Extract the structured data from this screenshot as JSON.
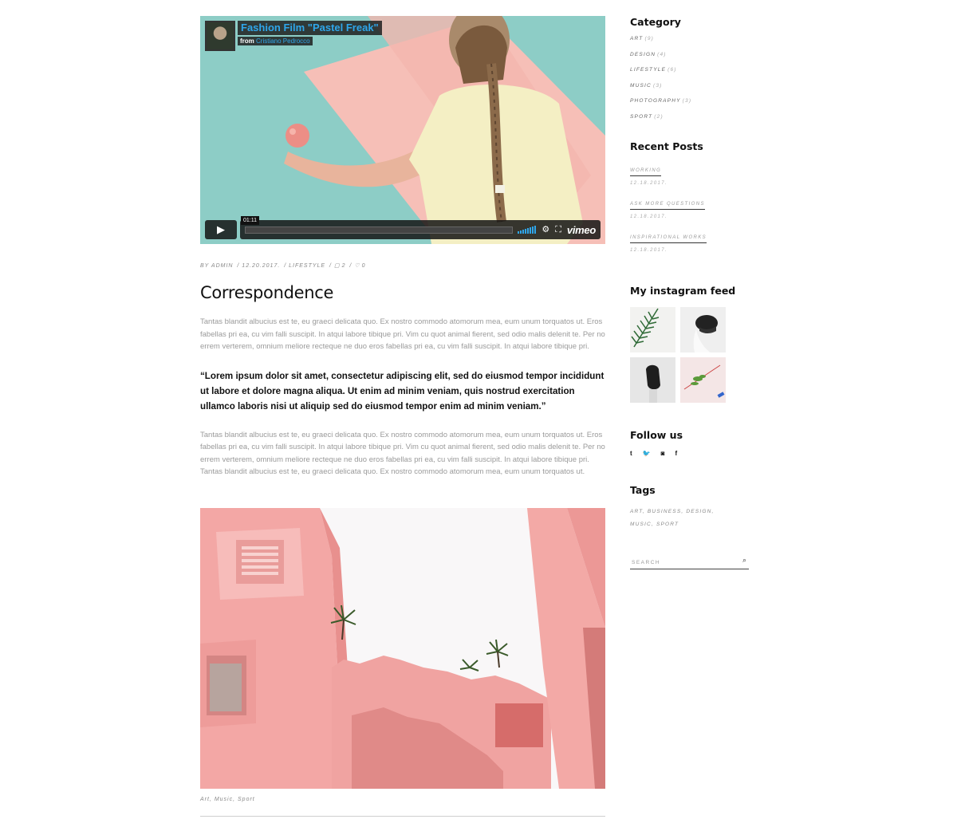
{
  "video": {
    "title": "Fashion Film \"Pastel Freak\"",
    "byline_prefix": "from",
    "author": "Cristiano Pedrocco",
    "time": "01:11",
    "progress": 0.0,
    "play_icon": "play-icon",
    "brand": "vimeo"
  },
  "post": {
    "meta": {
      "by": "BY ADMIN",
      "date": "12.20.2017.",
      "category": "LIFESTYLE",
      "comments": "2",
      "likes": "0"
    },
    "title": "Correspondence",
    "paragraph1": "Tantas blandit albucius est te, eu graeci delicata quo. Ex nostro commodo atomorum mea, eum unum torquatos ut. Eros fabellas pri ea, cu vim falli suscipit. In atqui labore tibique pri. Vim cu quot animal fierent, sed odio malis delenit te. Per no errem verterem, omnium meliore recteque ne duo eros fabellas pri ea, cu vim falli suscipit. In atqui labore tibique pri.",
    "quote": "“Lorem ipsum dolor sit amet, consectetur adipiscing elit, sed do eiusmod tempor incididunt ut labore et dolore magna aliqua. Ut enim ad minim veniam, quis nostrud exercitation ullamco laboris nisi ut aliquip sed do eiusmod tempor enim ad minim veniam.”",
    "paragraph2": "Tantas blandit albucius est te, eu graeci delicata quo. Ex nostro commodo atomorum mea, eum unum torquatos ut. Eros fabellas pri ea, cu vim falli suscipit. In atqui labore tibique pri. Vim cu quot animal fierent, sed odio malis delenit te. Per no errem verterem, omnium meliore recteque ne duo eros fabellas pri ea, cu vim falli suscipit. In atqui labore tibique pri. Tantas blandit albucius est te, eu graeci delicata quo. Ex nostro commodo atomorum mea, eum unum torquatos ut.",
    "tags": "Art, Music, Sport"
  },
  "sidebar": {
    "category": {
      "title": "Category",
      "items": [
        {
          "label": "ART",
          "count": "(9)"
        },
        {
          "label": "DESIGN",
          "count": "(4)"
        },
        {
          "label": "LIFESTYLE",
          "count": "(6)"
        },
        {
          "label": "MUSIC",
          "count": "(3)"
        },
        {
          "label": "PHOTOGRAPHY",
          "count": "(3)"
        },
        {
          "label": "SPORT",
          "count": "(2)"
        }
      ]
    },
    "recent": {
      "title": "Recent Posts",
      "items": [
        {
          "title": "WORKING",
          "date": "12.18.2017."
        },
        {
          "title": "ASK MORE QUESTIONS",
          "date": "12.18.2017."
        },
        {
          "title": "INSPIRATIONAL WORKS",
          "date": "12.18.2017."
        }
      ]
    },
    "instagram": {
      "title": "My instagram feed"
    },
    "follow": {
      "title": "Follow us",
      "icons": [
        "t",
        "🐦",
        "◙",
        "f"
      ]
    },
    "tags": {
      "title": "Tags",
      "text": "ART, BUSINESS, DESIGN, MUSIC, SPORT"
    },
    "search": {
      "placeholder": "SEARCH",
      "icon": "⌕"
    }
  },
  "colors": {
    "accent": "#2fa6ea",
    "pink": "#f2a6a4"
  }
}
